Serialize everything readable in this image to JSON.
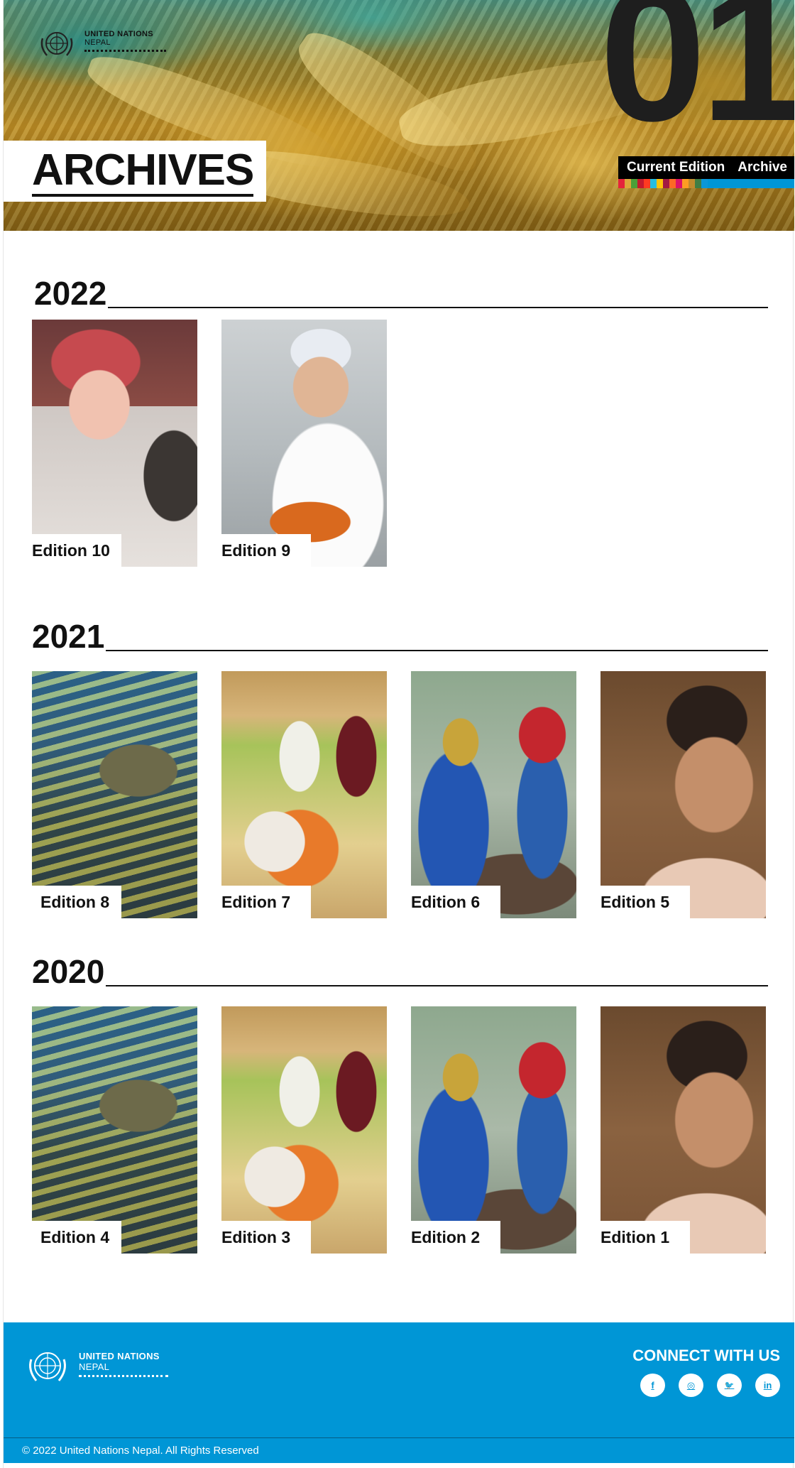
{
  "brand": {
    "line1": "UNITED NATIONS",
    "line2": "NEPAL"
  },
  "hero": {
    "title": "ARCHIVES",
    "edition_number": "01"
  },
  "nav": {
    "current_edition": "Current Edition",
    "archive": "Archive"
  },
  "sdg_colors": [
    "#e5243b",
    "#dda63a",
    "#4c9f38",
    "#c5192d",
    "#ff3a21",
    "#26bde2",
    "#fcc30b",
    "#a21942",
    "#fd6925",
    "#dd1367",
    "#fd9d24",
    "#bf8b2e",
    "#3f7e44",
    "#0a97d9"
  ],
  "years": [
    {
      "year": "2022",
      "editions": [
        {
          "label": "Edition 10",
          "image": "girl-photo"
        },
        {
          "label": "Edition 9",
          "image": "chef-photo"
        }
      ]
    },
    {
      "year": "2021",
      "editions": [
        {
          "label": "Edition 8",
          "image": "reef-photo"
        },
        {
          "label": "Edition 7",
          "image": "food-photo"
        },
        {
          "label": "Edition 6",
          "image": "parrots-photo"
        },
        {
          "label": "Edition 5",
          "image": "dancer-photo"
        }
      ]
    },
    {
      "year": "2020",
      "editions": [
        {
          "label": "Edition 4",
          "image": "reef-photo"
        },
        {
          "label": "Edition 3",
          "image": "food-photo"
        },
        {
          "label": "Edition 2",
          "image": "parrots-photo"
        },
        {
          "label": "Edition 1",
          "image": "dancer-photo"
        }
      ]
    }
  ],
  "footer": {
    "connect_label": "CONNECT WITH US",
    "socials": [
      {
        "icon": "facebook-icon",
        "glyph": "f"
      },
      {
        "icon": "instagram-icon",
        "glyph": "◎"
      },
      {
        "icon": "twitter-icon",
        "glyph": "🐦"
      },
      {
        "icon": "linkedin-icon",
        "glyph": "in"
      }
    ],
    "copyright": "© 2022 United Nations Nepal. All Rights Reserved",
    "bg_color": "#0096d6"
  }
}
